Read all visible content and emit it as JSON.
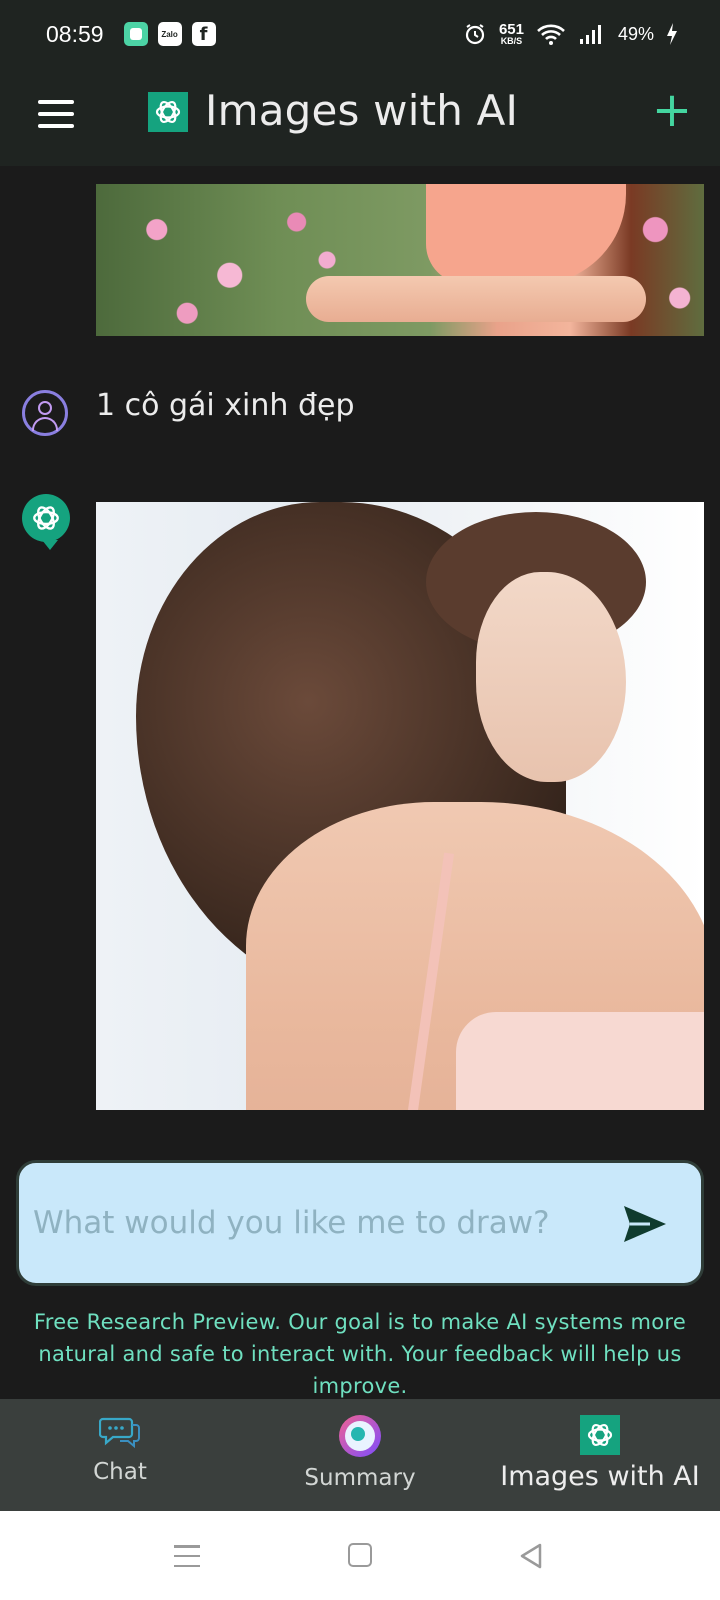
{
  "status_bar": {
    "time": "08:59",
    "notification_icons": [
      "app-icon",
      "zalo-icon",
      "facebook-icon"
    ],
    "zalo_text": "Zalo",
    "facebook_text": "f",
    "net_speed_value": "651",
    "net_speed_unit": "KB/S",
    "battery": "49%"
  },
  "app_bar": {
    "title": "Images with AI",
    "add_label": "+"
  },
  "messages": [
    {
      "role": "assistant",
      "type": "image",
      "description_icon": "image"
    },
    {
      "role": "user",
      "text": "1 cô gái xinh đẹp"
    },
    {
      "role": "assistant",
      "type": "image"
    }
  ],
  "input": {
    "placeholder": "What would you like me to draw?",
    "value": ""
  },
  "disclaimer": "Free Research Preview. Our goal is to make AI systems more natural and safe to interact with. Your feedback will help us improve.",
  "tabs": [
    {
      "label": "Chat",
      "icon": "chat-bubbles-icon",
      "active": false
    },
    {
      "label": "Summary",
      "icon": "summary-search-icon",
      "active": false
    },
    {
      "label": "Images with AI",
      "icon": "openai-logo-icon",
      "active": true
    }
  ],
  "colors": {
    "accent": "#15a37f",
    "plus": "#44d6a0",
    "input_bg": "#c9e8fa",
    "disclaimer": "#6fe0c0",
    "background": "#1b1b1b",
    "bar": "#1f2421",
    "tabbar": "#3a3f3d"
  }
}
